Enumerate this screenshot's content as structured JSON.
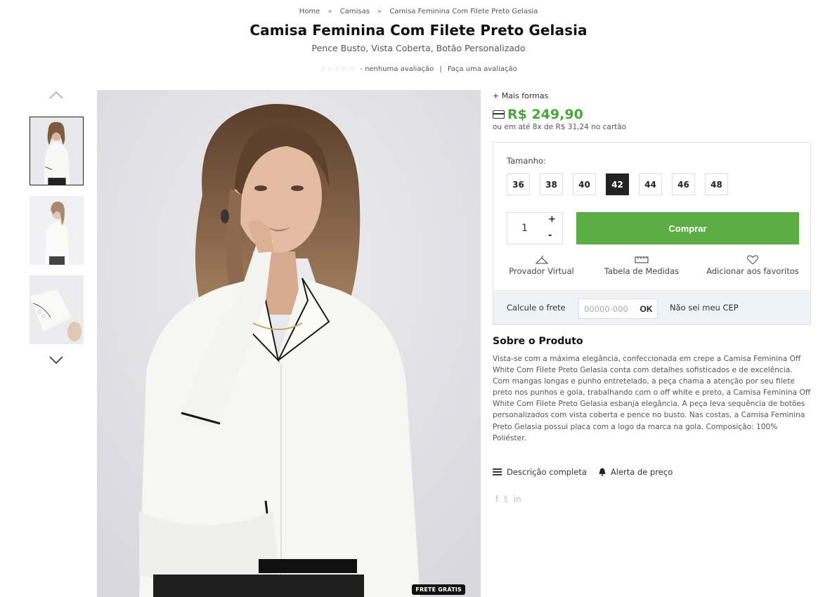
{
  "breadcrumb": {
    "items": [
      "Home",
      "Camisas",
      "Camisa Feminina Com Filete Preto Gelasia"
    ],
    "separator": "»"
  },
  "product": {
    "title": "Camisa Feminina Com Filete Preto Gelasia",
    "subtitle": "Pence Busto, Vista Coberta, Botão Personalizado",
    "rating_stars": "☆☆☆☆☆",
    "rating_text": "- nenhuma avaliação",
    "rating_divider": "|",
    "rating_link": "Faça uma avaliação",
    "rating_value": 0
  },
  "gallery": {
    "thumbnails": [
      "thumb-front",
      "thumb-side",
      "thumb-cuff"
    ],
    "active_index": 0,
    "badge": "FRETE GRÁTIS"
  },
  "purchase": {
    "more_ways": "+ Mais formas",
    "price": "R$ 249,90",
    "installments": "ou em até 8x de R$ 31,24 no cartão",
    "size_label": "Tamanho:",
    "sizes": [
      "36",
      "38",
      "40",
      "42",
      "44",
      "46",
      "48"
    ],
    "selected_size": "42",
    "quantity": "1",
    "qty_plus": "+",
    "qty_minus": "-",
    "buy_label": "Comprar",
    "actions": [
      "Provador Virtual",
      "Tabela de Medidas",
      "Adicionar aos favoritos"
    ],
    "accent_color": "#5cae44",
    "price_color": "#4aa63a"
  },
  "shipping": {
    "label": "Calcule o frete",
    "placeholder": "00000-000",
    "ok_label": "OK",
    "no_cep_link": "Não sei meu CEP"
  },
  "about": {
    "title": "Sobre o Produto",
    "text": "Vista-se com a máxima elegância, confeccionada em crepe a Camisa Feminina Off White Com Filete Preto Gelasia conta com detalhes sofisticados e de excelência. Com mangas longas e punho entretelado, a peça chama a atenção por seu filete preto nos punhos e gola, trabalhando com o off white e preto, a Camisa Feminina Off White Com Filete Preto Gelasia esbanja elegância. A peça leva sequência de botões personalizados com vista coberta e pence no busto. Nas costas, a Camisa Feminina Preto Gelasia possui placa com a logo da marca na gola. Composição: 100% Poliéster.",
    "full_description": "Descrição completa",
    "price_alert": "Alerta de preço"
  },
  "social": {
    "facebook": "f",
    "twitter": "𝕥",
    "linkedin": "in"
  }
}
